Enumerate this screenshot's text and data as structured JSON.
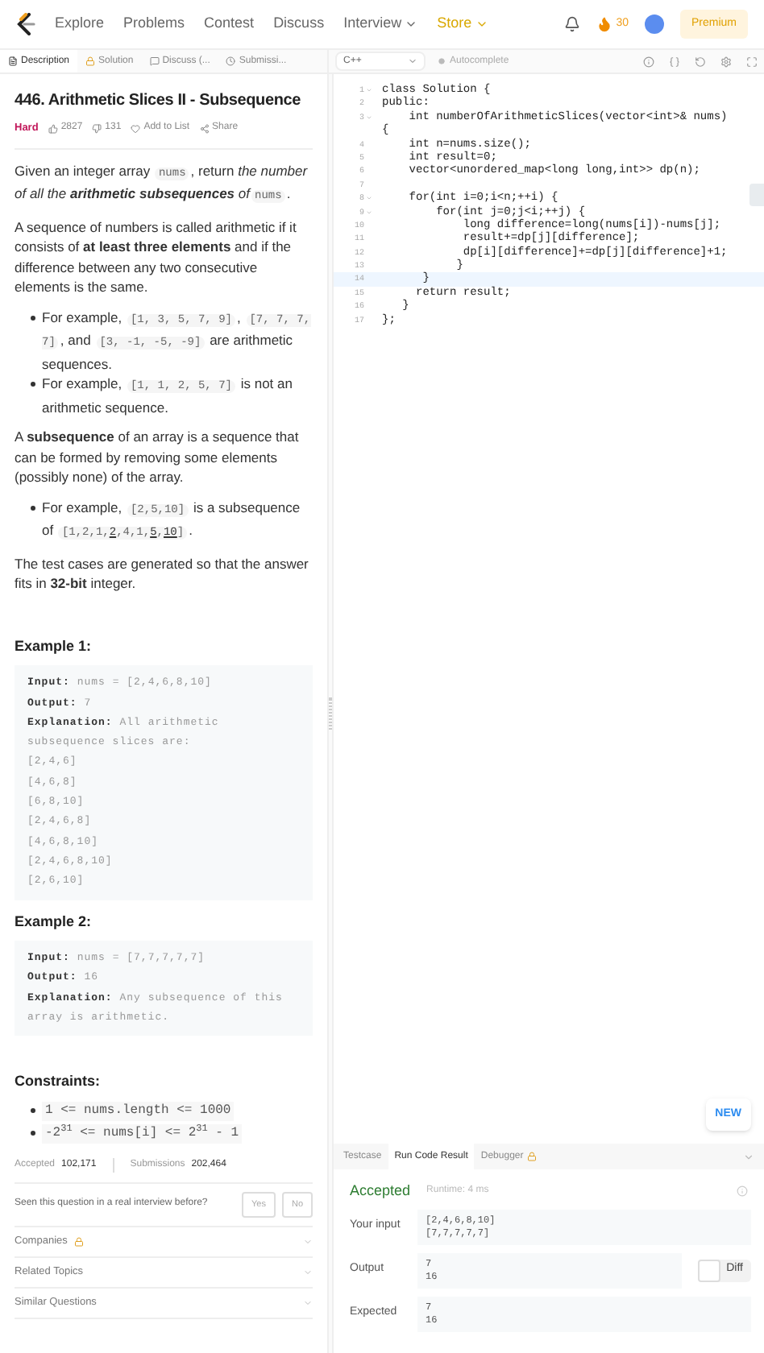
{
  "nav": {
    "items": [
      {
        "label": "Explore",
        "dropdown": false,
        "promo": false
      },
      {
        "label": "Problems",
        "dropdown": false,
        "promo": false
      },
      {
        "label": "Contest",
        "dropdown": false,
        "promo": false
      },
      {
        "label": "Discuss",
        "dropdown": false,
        "promo": false
      },
      {
        "label": "Interview",
        "dropdown": true,
        "promo": false
      },
      {
        "label": "Store",
        "dropdown": true,
        "promo": true
      }
    ],
    "coins": "30",
    "premium": "Premium"
  },
  "left_tabs": [
    {
      "kind": "description",
      "label": "Description",
      "selected": true
    },
    {
      "kind": "solution",
      "label": "Solution",
      "selected": false
    },
    {
      "kind": "discuss",
      "label": "Discuss (...",
      "selected": false
    },
    {
      "kind": "submissions",
      "label": "Submissi...",
      "selected": false
    }
  ],
  "editor_toolbar": {
    "language": "C++",
    "autocomplete": "Autocomplete"
  },
  "problem": {
    "title": "446. Arithmetic Slices II - Subsequence",
    "difficulty": "Hard",
    "likes": "2827",
    "dislikes": "131",
    "add_to_list": "Add to List",
    "share": "Share",
    "blocks": [
      {
        "kind": "p",
        "segments": [
          {
            "kind": "text",
            "text": "Given an integer array "
          },
          {
            "kind": "code",
            "text": "nums"
          },
          {
            "kind": "text",
            "text": ", return "
          },
          {
            "kind": "em",
            "text": "the number of all the **arithmetic subsequences** of"
          },
          {
            "kind": "code",
            "text": "nums"
          },
          {
            "kind": "text",
            "text": "."
          }
        ]
      },
      {
        "kind": "p",
        "segments": [
          {
            "kind": "text",
            "text": "A sequence of numbers is called arithmetic if it consists of **at least three elements** and if the difference between any two consecutive elements is the same."
          }
        ]
      },
      {
        "kind": "ul",
        "items": [
          {
            "segments": [
              {
                "kind": "text",
                "text": "For example, "
              },
              {
                "kind": "code",
                "text": "[1, 3, 5, 7, 9]"
              },
              {
                "kind": "text",
                "text": ", "
              },
              {
                "kind": "code",
                "text": "[7, 7, 7, 7]"
              },
              {
                "kind": "text",
                "text": ", and "
              },
              {
                "kind": "code",
                "text": "[3, -1, -5, -9]"
              },
              {
                "kind": "text",
                "text": " are arithmetic sequences."
              }
            ]
          },
          {
            "segments": [
              {
                "kind": "text",
                "text": "For example, "
              },
              {
                "kind": "code",
                "text": "[1, 1, 2, 5, 7]"
              },
              {
                "kind": "text",
                "text": " is not an arithmetic sequence."
              }
            ]
          }
        ]
      },
      {
        "kind": "p",
        "segments": [
          {
            "kind": "text",
            "text": "A **subsequence** of an array is a sequence that can be formed by removing some elements (possibly none) of the array."
          }
        ]
      },
      {
        "kind": "ul",
        "items": [
          {
            "segments": [
              {
                "kind": "text",
                "text": "For example, "
              },
              {
                "kind": "code",
                "text": "[2,5,10]"
              },
              {
                "kind": "text",
                "text": " is a subsequence of "
              },
              {
                "kind": "code",
                "parts": [
                  {
                    "text": "[1,2,1,",
                    "underlined": false
                  },
                  {
                    "text": "2",
                    "underlined": true
                  },
                  {
                    "text": ",4,1,",
                    "underlined": false
                  },
                  {
                    "text": "5",
                    "underlined": true
                  },
                  {
                    "text": ",",
                    "underlined": false
                  },
                  {
                    "text": "10",
                    "underlined": true
                  },
                  {
                    "text": "]",
                    "underlined": false
                  }
                ]
              },
              {
                "kind": "text",
                "text": "."
              }
            ]
          }
        ]
      },
      {
        "kind": "p",
        "segments": [
          {
            "kind": "text",
            "text": "The test cases are generated so that the answer fits in **32-bit** integer."
          }
        ]
      }
    ],
    "examples": [
      {
        "title": "Example 1:",
        "lines": [
          {
            "label": "Input:",
            "text": "nums = [2,4,6,8,10]"
          },
          {
            "label": "Output:",
            "text": "7"
          },
          {
            "label": "Explanation:",
            "text": "All arithmetic subsequence slices are:"
          },
          {
            "text": "[2,4,6]"
          },
          {
            "text": "[4,6,8]"
          },
          {
            "text": "[6,8,10]"
          },
          {
            "text": "[2,4,6,8]"
          },
          {
            "text": "[4,6,8,10]"
          },
          {
            "text": "[2,4,6,8,10]"
          },
          {
            "text": "[2,6,10]"
          }
        ]
      },
      {
        "title": "Example 2:",
        "lines": [
          {
            "label": "Input:",
            "text": "nums = [7,7,7,7,7]"
          },
          {
            "label": "Output:",
            "text": "16"
          },
          {
            "label": "Explanation:",
            "text": "Any subsequence of this array is arithmetic."
          }
        ]
      }
    ],
    "constraints_title": "Constraints:",
    "constraints": [
      "1  <= nums.length <= 1000",
      "-2$^{31}$ <= nums[i] <= 2$^{31}$ - 1"
    ],
    "stats": [
      {
        "label": "Accepted",
        "value": "102,171"
      },
      {
        "label": "Submissions",
        "value": "202,464"
      }
    ],
    "feedback": {
      "question": "Seen this question in a real interview before?",
      "buttons": [
        "Yes",
        "No"
      ]
    },
    "sections": [
      {
        "label": "Companies",
        "locked": true
      },
      {
        "label": "Related Topics",
        "locked": false
      },
      {
        "label": "Similar Questions",
        "locked": false
      }
    ]
  },
  "code": [
    {
      "number": "1",
      "foldable": true,
      "current": false,
      "text": "class Solution {"
    },
    {
      "number": "2",
      "foldable": false,
      "current": false,
      "text": "public:"
    },
    {
      "number": "3",
      "foldable": true,
      "current": false,
      "text": "    int numberOfArithmeticSlices(vector<int>& nums)"
    },
    {
      "foldable": false,
      "current": false,
      "text": "{"
    },
    {
      "number": "4",
      "foldable": false,
      "current": false,
      "text": "    int n=nums.size();"
    },
    {
      "number": "5",
      "foldable": false,
      "current": false,
      "text": "    int result=0;"
    },
    {
      "number": "6",
      "foldable": false,
      "current": false,
      "text": "    vector<unordered_map<long long,int>> dp(n);"
    },
    {
      "number": "7",
      "foldable": false,
      "current": false
    },
    {
      "number": "8",
      "foldable": true,
      "current": false,
      "text": "    for(int i=0;i<n;++i) {"
    },
    {
      "number": "9",
      "foldable": true,
      "current": false,
      "text": "        for(int j=0;j<i;++j) {"
    },
    {
      "number": "10",
      "foldable": false,
      "current": false,
      "text": "            long difference=long(nums[i])-nums[j];"
    },
    {
      "number": "11",
      "foldable": false,
      "current": false,
      "text": "            result+=dp[j][difference];"
    },
    {
      "number": "12",
      "foldable": false,
      "current": false,
      "text": "            dp[i][difference]+=dp[j][difference]+1;"
    },
    {
      "number": "13",
      "foldable": false,
      "current": false,
      "text": "           }"
    },
    {
      "number": "14",
      "foldable": false,
      "current": true,
      "text": "      }"
    },
    {
      "number": "15",
      "foldable": false,
      "current": false,
      "text": "     return result;"
    },
    {
      "number": "16",
      "foldable": false,
      "current": false,
      "text": "   }"
    },
    {
      "number": "17",
      "foldable": false,
      "current": false,
      "text": "};"
    }
  ],
  "new_badge": "NEW",
  "console": {
    "tabs": [
      {
        "label": "Testcase",
        "selected": false,
        "locked": false
      },
      {
        "label": "Run Code Result",
        "selected": true,
        "locked": false
      },
      {
        "label": "Debugger",
        "selected": false,
        "locked": true
      }
    ],
    "status": "Accepted",
    "runtime": "Runtime: 4 ms",
    "rows": [
      {
        "label": "Your input",
        "lines": [
          "[2,4,6,8,10]",
          "[7,7,7,7,7]"
        ]
      },
      {
        "label": "Output",
        "lines": [
          "7",
          "16"
        ],
        "diff": "Diff",
        "diff_on": false
      },
      {
        "label": "Expected",
        "lines": [
          "7",
          "16"
        ]
      }
    ]
  }
}
